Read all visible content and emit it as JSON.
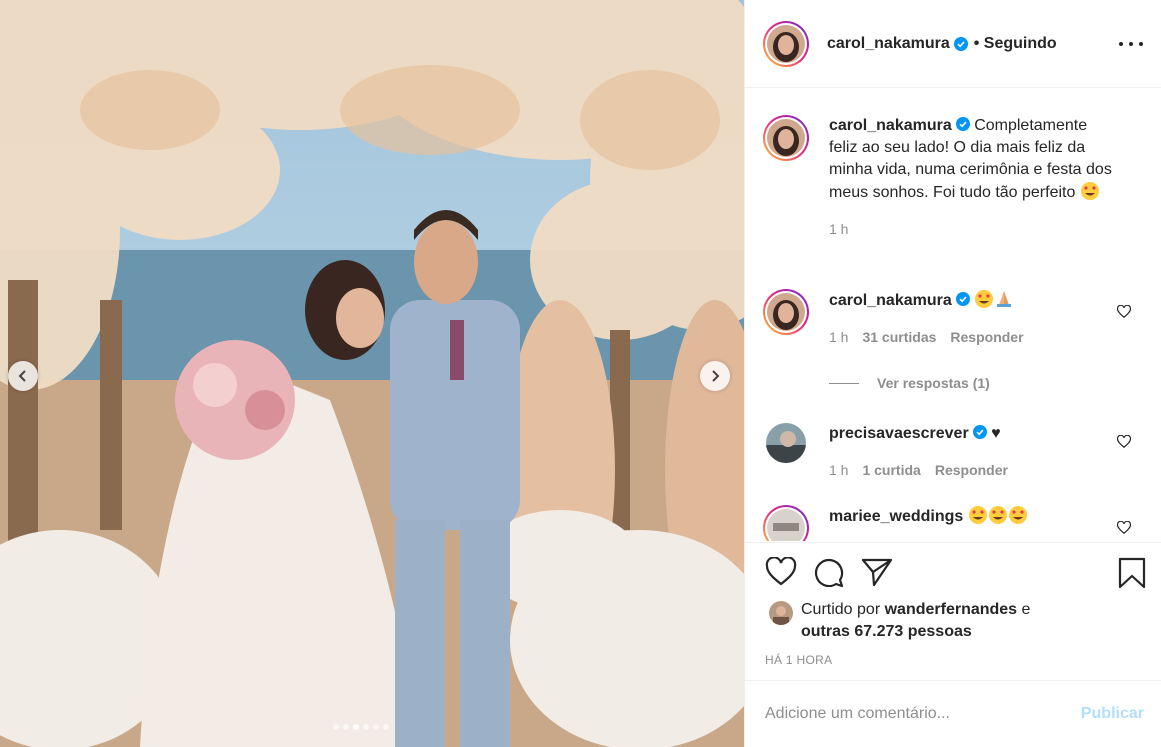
{
  "post": {
    "author": "carol_nakamura",
    "follow_status": "• Seguindo",
    "caption": "Completamente feliz ao seu lado! O dia mais feliz da minha vida, numa cerimônia e festa dos meus sonhos. Foi tudo tão perfeito",
    "caption_time": "1 h",
    "carousel": {
      "total": 6,
      "active_index": 2
    }
  },
  "comments": [
    {
      "user": "carol_nakamura",
      "text": "",
      "emojis": [
        "heart-eyes-emoji",
        "praying-hands-emoji"
      ],
      "time": "1 h",
      "likes": "31 curtidas",
      "reply": "Responder",
      "view_replies": "Ver respostas (1)"
    },
    {
      "user": "precisavaescrever",
      "text": "♥",
      "time": "1 h",
      "likes": "1 curtida",
      "reply": "Responder"
    },
    {
      "user": "mariee_weddings",
      "text": "",
      "emojis": [
        "heart-eyes-emoji",
        "heart-eyes-emoji",
        "heart-eyes-emoji"
      ]
    }
  ],
  "likes_line": {
    "prefix": "Curtido por ",
    "user": "wanderfernandes",
    "connector": " e",
    "others": "outras 67.273 pessoas"
  },
  "timestamp": "HÁ 1 HORA",
  "comment_box": {
    "placeholder": "Adicione um comentário...",
    "submit": "Publicar"
  },
  "colors": {
    "verified": "#0095f6",
    "muted": "#8e8e8e",
    "submit_disabled": "#b2dffc",
    "text": "#262626"
  }
}
